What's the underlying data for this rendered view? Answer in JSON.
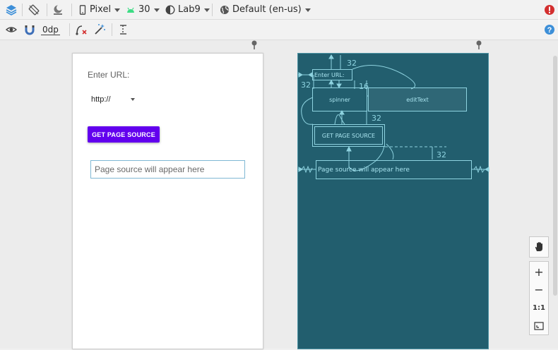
{
  "toolbar_top": {
    "device": "Pixel",
    "api_level": "30",
    "theme": "Lab9",
    "locale": "Default (en-us)"
  },
  "toolbar_second": {
    "margin_value": "0dp"
  },
  "design": {
    "url_label": "Enter URL:",
    "protocol_selected": "http://",
    "button_label": "GET PAGE SOURCE",
    "source_placeholder": "Page source will appear here"
  },
  "blueprint": {
    "url_label": "Enter URL:",
    "spinner_label": "spinner",
    "edittext_label": "editText",
    "button_label": "GET PAGE SOURCE",
    "source_placeholder": "Page source will appear here",
    "margin_top": "32",
    "margin_label": "32",
    "margin_spinner_right": "16",
    "margin_button": "32",
    "margin_source": "32"
  },
  "zoom_panel": {
    "zoom_in": "+",
    "zoom_out": "−",
    "actual_size": "1:1"
  },
  "colors": {
    "primary": "#6200ee",
    "blueprint_bg": "#225e6e",
    "blueprint_line": "#8ed3e0",
    "error": "#d32f2f",
    "help": "#3d8fd8",
    "android_green": "#3ddc84"
  }
}
